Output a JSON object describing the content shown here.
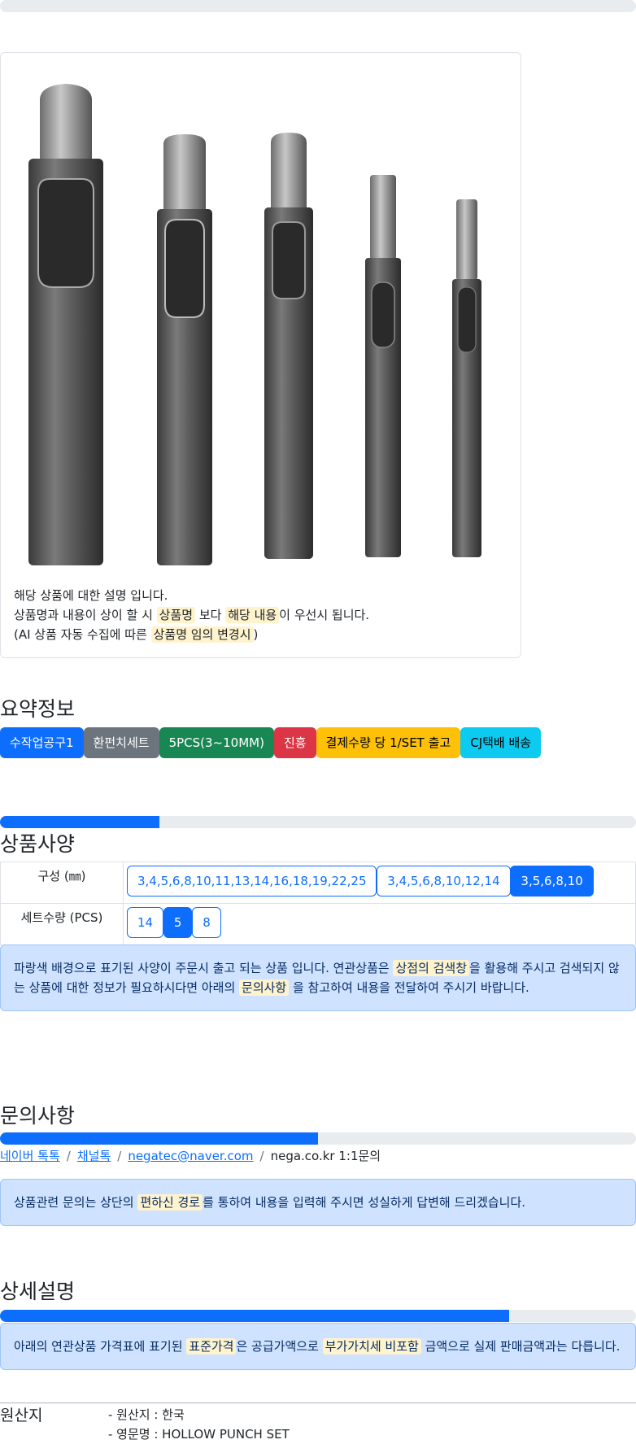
{
  "top_progress": {
    "fill": 0.0
  },
  "product_card": {
    "line1": "해당 상품에 대한 설명 입니다.",
    "line2_pre": "상품명과 내용이 상이 할 시 ",
    "line2_mark1": "상품명",
    "line2_mid": " 보다 ",
    "line2_mark2": "해당 내용",
    "line2_post": "이 우선시 됩니다.",
    "line3_pre": "(AI 상품 자동 수집에 따른 ",
    "line3_mark": "상품명 임의 변경시",
    "line3_post": ")",
    "image_alt": "hollow-punch-set-photo"
  },
  "summary": {
    "title": "요약정보",
    "badges": [
      {
        "label": "수작업공구1",
        "color": "#0d6efd"
      },
      {
        "label": "환펀치세트",
        "color": "#6c757d"
      },
      {
        "label": "5PCS(3~10MM)",
        "color": "#198754"
      },
      {
        "label": "진흥",
        "color": "#dc3545"
      },
      {
        "label": "결제수량 당 1/SET 출고",
        "color": "#ffc107"
      },
      {
        "label": "CJ택배 배송",
        "color": "#0dcaf0"
      }
    ]
  },
  "spec": {
    "progress": 0.25,
    "title": "상품사양",
    "rows": [
      {
        "header": "구성 (㎜)",
        "options": [
          "3,4,5,6,8,10,11,13,14,16,18,19,22,25",
          "3,4,5,6,8,10,12,14",
          "3,5,6,8,10"
        ],
        "active": 2
      },
      {
        "header": "세트수량 (PCS)",
        "options": [
          "14",
          "5",
          "8"
        ],
        "active": 1
      }
    ],
    "notice_pre": "파랑색 배경으로 표기된 사양이 주문시 출고 되는 상품 입니다. 연관상품은 ",
    "notice_mark1": "상점의 검색창",
    "notice_mid": "을 활용해 주시고 검색되지 않는 상품에 대한 정보가 필요하시다면 아래의 ",
    "notice_mark2": "문의사항",
    "notice_post": " 을 참고하여 내용을 전달하여 주시기 바랍니다."
  },
  "inquiry": {
    "progress": 0.5,
    "title": "문의사항",
    "links": [
      "네이버 톡톡",
      "채널톡",
      "negatec@naver.com"
    ],
    "plain": "nega.co.kr 1:1문의",
    "separator": "/",
    "notice_pre": "상품관련 문의는 상단의 ",
    "notice_mark": "편하신 경로",
    "notice_post": "를 통하여 내용을 입력해 주시면 성실하게 답변해 드리겠습니다."
  },
  "detail": {
    "progress": 0.8,
    "title": "상세설명",
    "notice_pre": "아래의 연관상품 가격표에 표기된 ",
    "notice_mark1": "표준가격",
    "notice_mid": "은 공급가액으로 ",
    "notice_mark2": "부가가치세 비포함",
    "notice_post": " 금액으로 실제 판매금액과는 다릅니다."
  },
  "origin": {
    "label": "원산지",
    "line1": "- 원산지 : 한국",
    "line2": "- 영문명 : HOLLOW PUNCH SET"
  }
}
